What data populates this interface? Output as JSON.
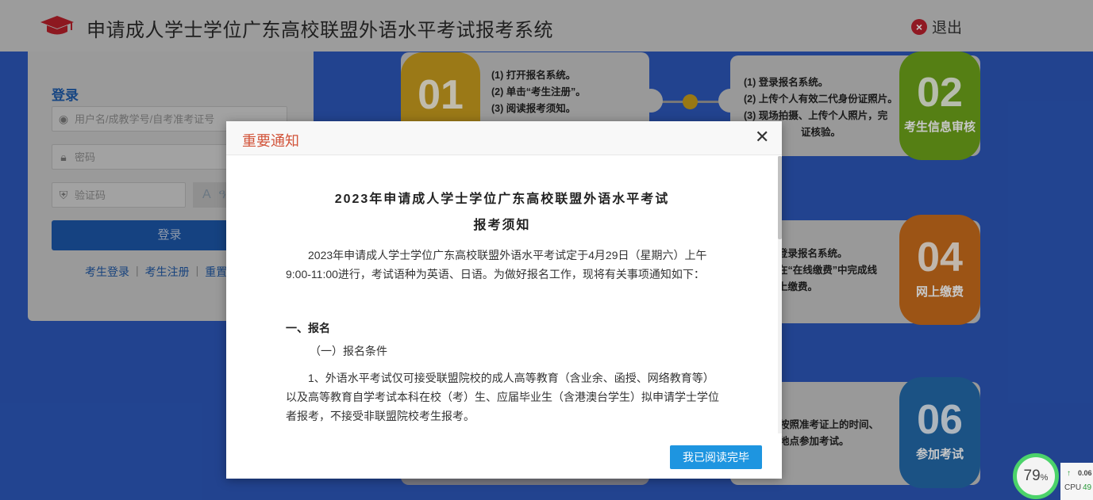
{
  "header": {
    "title": "申请成人学士学位广东高校联盟外语水平考试报考系统",
    "logout_label": "退出"
  },
  "login": {
    "title": "登录",
    "username_placeholder": "用户名/成教学号/自考准考证号",
    "password_placeholder": "密码",
    "captcha_placeholder": "验证码",
    "captcha_text": "A ዓ A",
    "submit_label": "登录",
    "links": [
      "考生登录",
      "考生注册",
      "重置"
    ]
  },
  "steps": {
    "s01": {
      "num": "01",
      "lines": [
        "(1) 打开报名系统。",
        "(2) 单击“考生注册”。",
        "(3) 阅读报考须知。"
      ]
    },
    "s02": {
      "num": "02",
      "label": "考生信息审核",
      "lines": [
        "(1) 登录报名系统。",
        "(2) 上传个人有效二代身份证照片。",
        "(3) 现场拍摄、上传个人照片，完",
        "证核验。"
      ]
    },
    "s04": {
      "num": "04",
      "label": "网上缴费",
      "lines": [
        "登录报名系统。",
        "在“在线缴费”中完成线",
        "上缴费。"
      ]
    },
    "s06": {
      "num": "06",
      "label": "参加考试",
      "lines": [
        "按照准考证上的时间、",
        "地点参加考试。"
      ]
    },
    "colors": {
      "s01": "#c79c1e",
      "s02": "#6da31a",
      "s04": "#c86c1b",
      "s06": "#236aaa"
    }
  },
  "modal": {
    "title": "重要通知",
    "close_icon": "close-icon",
    "doc_title_line1": "2023年申请成人学士学位广东高校联盟外语水平考试",
    "doc_title_line2": "报考须知",
    "intro": "2023年申请成人学士学位广东高校联盟外语水平考试定于4月29日（星期六）上午9:00-11:00进行，考试语种为英语、日语。为做好报名工作，现将有关事项通知如下：",
    "section1": "一、报名",
    "subsection1": "（一）报名条件",
    "item1": "1、外语水平考试仅可接受联盟院校的成人高等教育（含业余、函授、网络教育等）以及高等教育自学考试本科在校（考）生、应届毕业生（含港澳台学生）拟申请学士学位者报考，不接受非联盟院校考生报考。",
    "confirm_label": "我已阅读完毕"
  },
  "cpu_widget": {
    "percent": "79",
    "unit": "%",
    "net_value": "0.06",
    "cpu_label": "CPU",
    "cpu_value": "49"
  }
}
